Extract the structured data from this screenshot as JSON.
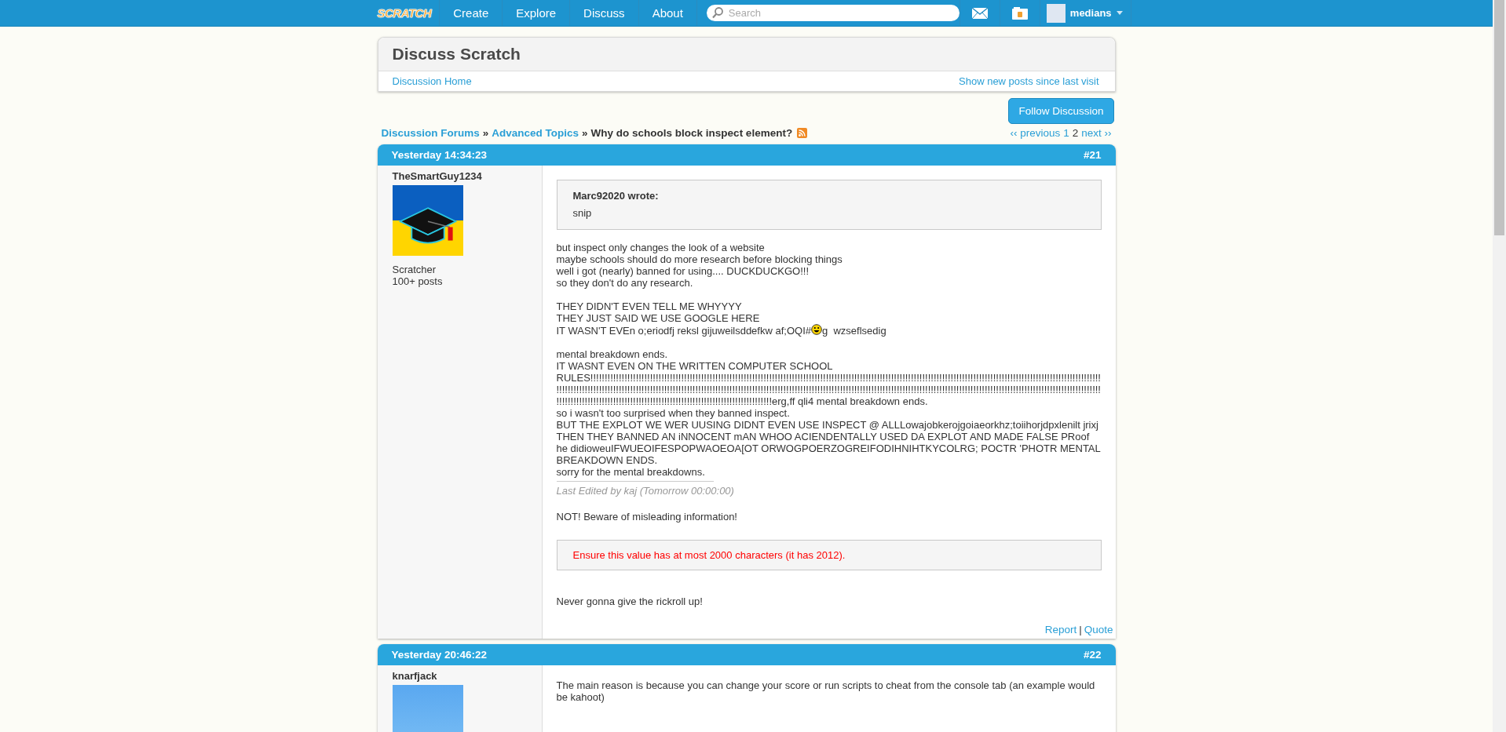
{
  "nav": {
    "logo": "SCRATCH",
    "items": [
      {
        "label": "Create"
      },
      {
        "label": "Explore"
      },
      {
        "label": "Discuss"
      },
      {
        "label": "About"
      }
    ],
    "search": {
      "placeholder": "Search"
    },
    "user": {
      "name": "medians"
    }
  },
  "header": {
    "title": "Discuss Scratch",
    "home_link": "Discussion Home",
    "new_posts_link": "Show new posts since last visit"
  },
  "follow_button": "Follow Discussion",
  "breadcrumb": [
    {
      "kind": "link",
      "label": "Discussion Forums"
    },
    {
      "kind": "sep",
      "label": "»"
    },
    {
      "kind": "link",
      "label": "Advanced Topics"
    },
    {
      "kind": "sep",
      "label": "»"
    },
    {
      "kind": "current",
      "label": "Why do schools block inspect element?"
    }
  ],
  "pagination": {
    "previous": "‹‹ previous",
    "pages": [
      {
        "label": "1",
        "selected": false
      },
      {
        "label": "2",
        "selected": true
      }
    ],
    "next": "next ››"
  },
  "posts": [
    {
      "time": "Yesterday 14:34:23",
      "number": "#21",
      "author": "TheSmartGuy1234",
      "avatar": {
        "kind": "cap"
      },
      "rank": "Scratcher",
      "post_count": "100+ posts",
      "blocks": [
        {
          "kind": "quote",
          "author": "Marc92020 wrote:",
          "text": "snip"
        },
        {
          "kind": "text",
          "lines": [
            "but inspect only changes the look of a website",
            "maybe schools should do more research before blocking things",
            "well i got (nearly) banned for using.... DUCKDUCKGO!!!",
            "so they don't do any research."
          ]
        },
        {
          "kind": "text",
          "lines": [
            "THEY DIDN'T EVEN TELL ME WHYYYY",
            "THEY JUST SAID WE USE GOOGLE HERE",
            {
              "before": "IT WASN'T EVEn o;eriodfj reksl gijuweilsddefkw af;OQI#",
              "after": "g  wzseflsedig"
            }
          ]
        },
        {
          "kind": "text",
          "lines": [
            "mental breakdown ends.",
            "IT WASNT EVEN ON THE WRITTEN COMPUTER SCHOOL",
            "RULES!!!!!!!!!!!!!!!!!!!!!!!!!!!!!!!!!!!!!!!!!!!!!!!!!!!!!!!!!!!!!!!!!!!!!!!!!!!!!!!!!!!!!!!!!!!!!!!!!!!!!!!!!!!!!!!!!!!!!!!!!!!!!!!!!!!!!!!!!!!!!!!!!!!!!!!!!!!!!!!!!!!!!!!!!!!!!!!!!!!!!!!!!!!!!!!!!!!!!!!!!!!!!!!!!!!!!!!!!!!!!!!!!!!!!!!!!!!!!!!!!!!!!!!!!!!!!!!!!!!!!!!!!!!!!!!!!!!!!!!!!!!!!!!!!!!!!!!!!!!!!!!!!!!!!!!!!!!!!!!!!!!!!!!!!!!!!!!!!!!!!!!!!!!!!!!!!!!!!!!!!!!!!!!!!!!!!!!!!!!!!!!!!!!!!!!!!!!!!!!!!!!!!!!!!!!!!!!!!!!!!!!!!!!!!!!!!!!!!!!!!!!!!!!!erg,ff qli4 mental breakdown ends.",
            "so i wasn't too surprised when they banned inspect.",
            "BUT THE EXPLOT WE WER UUSING DIDNT EVEN USE INSPECT @ ALLLowajobkerojgoiaeorkhz;toiihorjdpxlenilt jrixj",
            "THEN THEY BANNED AN iNNOCENT mAN WHOO ACIENDENTALLY USED DA EXPLOT AND MADE FALSE PRoof he didioweuIFWUEOIFESPOPWAOEOA[OT ORWOGPOERZOGREIFODIHNIHTKYCOLRG; POCTR 'PHOTR MENTAL BREAKDOWN ENDS.",
            "sorry for the mental breakdowns."
          ]
        },
        {
          "kind": "edit",
          "text": "Last Edited by kaj (Tomorrow 00:00:00)"
        },
        {
          "kind": "text",
          "lines": [
            "NOT! Beware of misleading information!"
          ]
        },
        {
          "kind": "error",
          "text": "Ensure this value has at most 2000 characters (it has 2012)."
        },
        {
          "kind": "text",
          "lines": [
            "Never gonna give the rickroll up!"
          ]
        }
      ],
      "actions": [
        {
          "label": "Report"
        },
        {
          "label": "Quote"
        }
      ],
      "action_separator": "|"
    },
    {
      "time": "Yesterday 20:46:22",
      "number": "#22",
      "author": "knarfjack",
      "avatar": {
        "kind": "plain"
      },
      "blocks": [
        {
          "kind": "text",
          "lines": [
            "The main reason is because you can change your score or run scripts to cheat from the console tab (an example would be kahoot)"
          ]
        }
      ]
    }
  ]
}
